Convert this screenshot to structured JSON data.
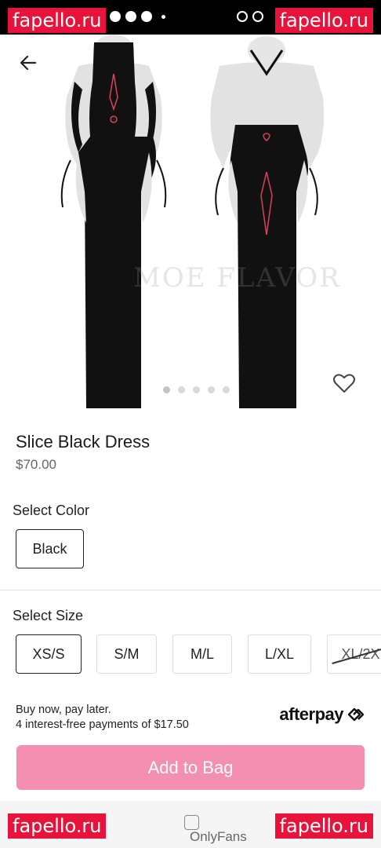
{
  "watermark": {
    "text": "fapello.ru"
  },
  "gallery": {
    "brand_logo": "MOE FLAVOR",
    "image_count": 5,
    "active_index": 0
  },
  "product": {
    "title": "Slice Black Dress",
    "price": "$70.00"
  },
  "color": {
    "label": "Select Color",
    "options": [
      "Black"
    ],
    "selected": "Black"
  },
  "size": {
    "label": "Select Size",
    "options": [
      "XS/S",
      "S/M",
      "M/L",
      "L/XL",
      "XL/2X"
    ],
    "selected": "XS/S",
    "unavailable": [
      "XL/2X"
    ]
  },
  "payment": {
    "line1": "Buy now, pay later.",
    "line2": "4 interest-free payments of $17.50",
    "provider": "afterpay"
  },
  "cta": {
    "add_to_bag": "Add to Bag"
  },
  "bottom_nav": {
    "label": "OnlyFans"
  },
  "colors": {
    "accent": "#f48fb1",
    "watermark": "#e8123a",
    "dress": "#111111"
  }
}
